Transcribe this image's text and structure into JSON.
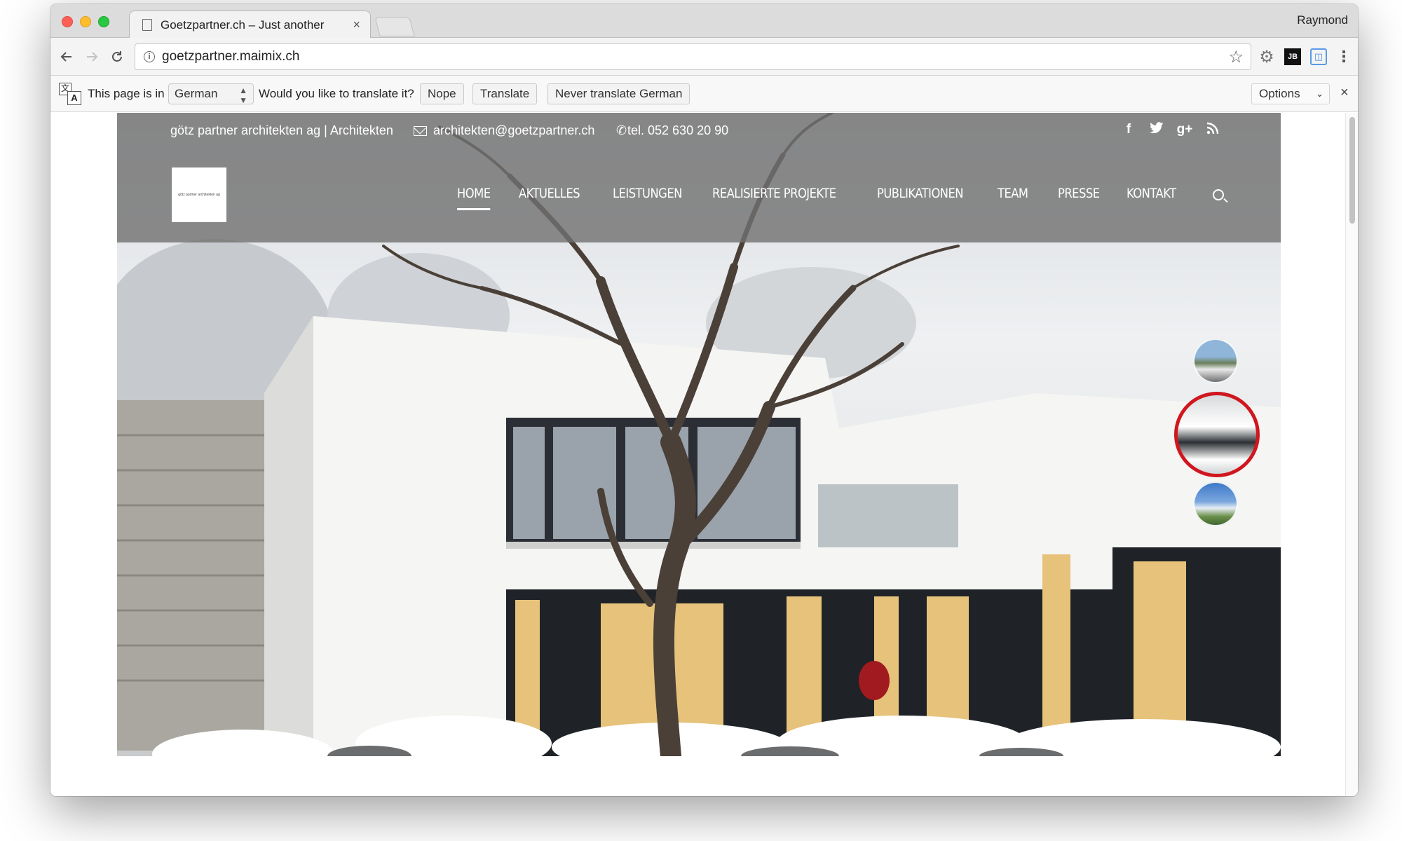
{
  "browser": {
    "tab_title": "Goetzpartner.ch – Just another",
    "tab_close": "×",
    "profile_name": "Raymond",
    "url": "goetzpartner.maimix.ch",
    "icons": [
      "back-arrow-icon",
      "forward-arrow-icon",
      "reload-icon",
      "info-icon",
      "star-icon",
      "gear-extension-icon",
      "jb-extension-icon",
      "blue-extension-icon",
      "menu-dots-icon"
    ],
    "ext_jb_label": "JB",
    "ext_blue_label": "◫"
  },
  "translate_bar": {
    "prefix": "This page is in",
    "language": "German",
    "question": "Would you like to translate it?",
    "nope": "Nope",
    "translate": "Translate",
    "never": "Never translate German",
    "options": "Options",
    "close": "×"
  },
  "site": {
    "company": "götz partner architekten ag | Architekten",
    "email": "architekten@goetzpartner.ch",
    "phone": "tel. 052 630 20 90",
    "logo_text": "götz partner architekten ag",
    "social": [
      "f",
      "t",
      "g+",
      "rss"
    ],
    "nav": [
      "HOME",
      "AKTUELLES",
      "LEISTUNGEN",
      "REALISIERTE PROJEKTE",
      "PUBLIKATIONEN",
      "TEAM",
      "PRESSE",
      "KONTAKT"
    ],
    "active_nav": "HOME",
    "slider_active_index": 1,
    "colors": {
      "header_overlay": "#707070",
      "slider_active_ring": "#d0161e"
    }
  }
}
